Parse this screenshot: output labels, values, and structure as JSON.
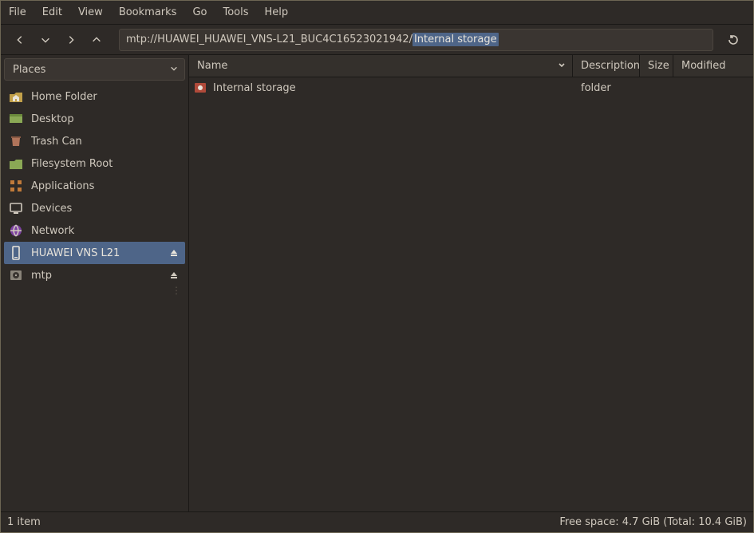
{
  "menu": [
    "File",
    "Edit",
    "View",
    "Bookmarks",
    "Go",
    "Tools",
    "Help"
  ],
  "address": {
    "prefix": "mtp://HUAWEI_HUAWEI_VNS-L21_BUC4C16523021942/",
    "selected": "Internal storage"
  },
  "sidebar": {
    "header": "Places",
    "items": [
      {
        "id": "home",
        "label": "Home Folder",
        "icon": "home-folder-icon"
      },
      {
        "id": "desk",
        "label": "Desktop",
        "icon": "desktop-icon"
      },
      {
        "id": "trash",
        "label": "Trash Can",
        "icon": "trash-icon"
      },
      {
        "id": "fsroot",
        "label": "Filesystem Root",
        "icon": "folder-icon"
      },
      {
        "id": "apps",
        "label": "Applications",
        "icon": "apps-icon"
      },
      {
        "id": "dev",
        "label": "Devices",
        "icon": "device-icon"
      },
      {
        "id": "net",
        "label": "Network",
        "icon": "network-icon"
      },
      {
        "id": "huawei",
        "label": "HUAWEI VNS L21",
        "icon": "phone-icon",
        "eject": true,
        "active": true
      },
      {
        "id": "mtp",
        "label": "mtp",
        "icon": "disk-icon",
        "eject": true
      }
    ]
  },
  "columns": {
    "name": "Name",
    "description": "Description",
    "size": "Size",
    "modified": "Modified"
  },
  "rows": [
    {
      "name": "Internal storage",
      "description": "folder",
      "size": "",
      "modified": ""
    }
  ],
  "status": {
    "left": "1 item",
    "right": "Free space: 4.7 GiB (Total: 10.4 GiB)"
  },
  "colors": {
    "accent": "#4e6588",
    "folder_yellow": "#c2a04a",
    "folder_green": "#8aa855",
    "trash": "#b0745a",
    "network": "#7b3fa0"
  }
}
